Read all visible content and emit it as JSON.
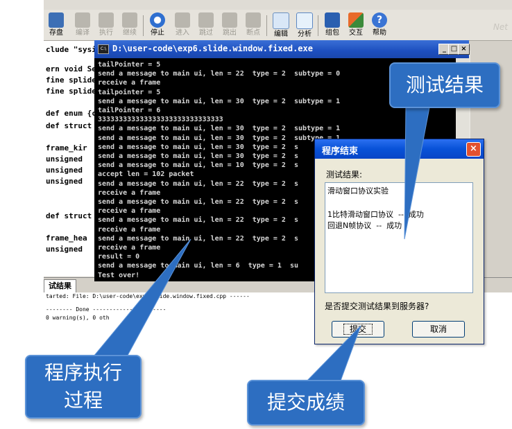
{
  "toolbar": {
    "buttons": [
      {
        "label": "存盘",
        "enabled": true,
        "icon": "save-icon"
      },
      {
        "label": "编译",
        "enabled": false,
        "icon": "compile-icon"
      },
      {
        "label": "执行",
        "enabled": false,
        "icon": "run-icon"
      },
      {
        "label": "继续",
        "enabled": false,
        "icon": "continue-icon"
      },
      {
        "label": "停止",
        "enabled": true,
        "icon": "stop-icon"
      },
      {
        "label": "进入",
        "enabled": false,
        "icon": "step-in-icon"
      },
      {
        "label": "跳过",
        "enabled": false,
        "icon": "step-over-icon"
      },
      {
        "label": "跳出",
        "enabled": false,
        "icon": "step-out-icon"
      },
      {
        "label": "断点",
        "enabled": false,
        "icon": "breakpoint-icon"
      },
      {
        "label": "编辑",
        "enabled": true,
        "icon": "edit-icon"
      },
      {
        "label": "分析",
        "enabled": true,
        "icon": "analyze-icon"
      },
      {
        "label": "组包",
        "enabled": true,
        "icon": "package-icon"
      },
      {
        "label": "交互",
        "enabled": true,
        "icon": "interact-icon"
      },
      {
        "label": "帮助",
        "enabled": true,
        "icon": "help-icon"
      }
    ],
    "watermark": "Net"
  },
  "editor": {
    "lines": [
      "clude \"sysir",
      "ern void Ser",
      "fine splide_",
      "fine splide_",
      "",
      "def enum {c",
      "def struct",
      "",
      "  frame_kir",
      "  unsigned",
      "  unsigned",
      "  unsigned",
      "",
      "",
      "def struct",
      "",
      "  frame_hea",
      "  unsigned"
    ]
  },
  "output": {
    "tab_label": "试结果",
    "lines": [
      "tarted: File: D:\\user-code\\exp6.slide.window.fixed.cpp ------",
      "-------- Done ----------------------",
      " 0 warning(s), 0 oth"
    ]
  },
  "console": {
    "title": "D:\\user-code\\exp6.slide.window.fixed.exe",
    "title_icon": "C:\\",
    "lines": [
      "tailPointer = 5",
      "send a message to main ui, len = 22  type = 2  subtype = 0",
      "receive a frame",
      "tailpointer = 5",
      "send a message to main ui, len = 30  type = 2  subtype = 1",
      "tailPointer = 6",
      "333333333333333333333333333333",
      "send a message to main ui, len = 30  type = 2  subtype = 1",
      "send a message to main ui, len = 30  type = 2  subtype = 1",
      "send a message to main ui, len = 30  type = 2  s",
      "send a message to main ui, len = 30  type = 2  s",
      "send a message to main ui, len = 10  type = 2  s",
      "accept len = 102 packet",
      "send a message to main ui, len = 22  type = 2  s",
      "receive a frame",
      "send a message to main ui, len = 22  type = 2  s",
      "receive a frame",
      "send a message to main ui, len = 22  type = 2  s",
      "receive a frame",
      "send a message to main ui, len = 22  type = 2  s",
      "receive a frame",
      "result = 0",
      "send a message to main ui, len = 6  type = 1  su",
      "Test over!"
    ],
    "btn_minimize": "_",
    "btn_maximize": "□",
    "btn_close": "×"
  },
  "dialog": {
    "title": "程序结束",
    "close_label": "×",
    "result_label": "测试结果:",
    "result_lines": [
      "滑动窗口协议实验",
      "",
      "1比特滑动窗口协议  --  成功",
      "回退N帧协议  --  成功"
    ],
    "question": "是否提交测试结果到服务器?",
    "submit_label": "提交",
    "cancel_label": "取消"
  },
  "callouts": {
    "test_result": "测试结果",
    "process_line1": "程序执行",
    "process_line2": "过程",
    "submit_grade": "提交成绩",
    "color": "#2d6ec1"
  }
}
